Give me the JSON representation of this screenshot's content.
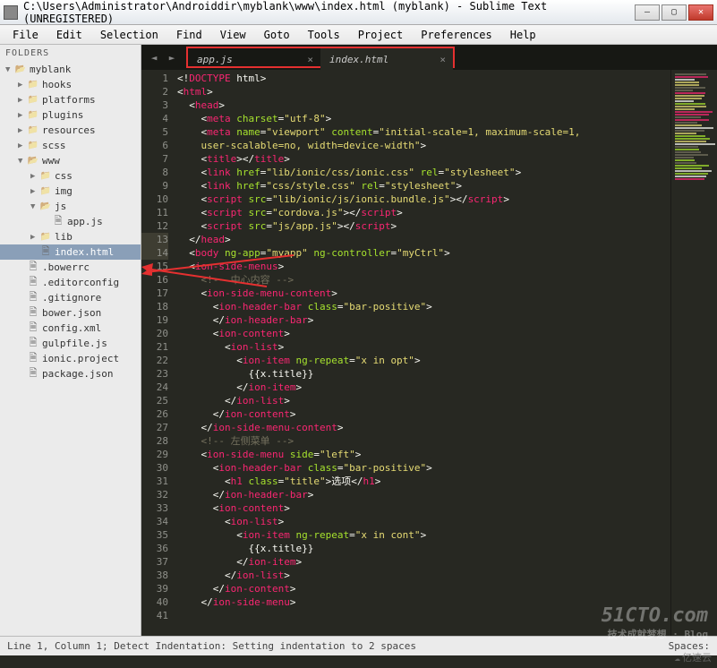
{
  "titlebar": {
    "title": "C:\\Users\\Administrator\\Androiddir\\myblank\\www\\index.html (myblank) - Sublime Text (UNREGISTERED)"
  },
  "menu": [
    "File",
    "Edit",
    "Selection",
    "Find",
    "View",
    "Goto",
    "Tools",
    "Project",
    "Preferences",
    "Help"
  ],
  "sidebar": {
    "header": "FOLDERS",
    "tree": [
      {
        "depth": 0,
        "arrow": "▼",
        "kind": "folder",
        "open": true,
        "label": "myblank"
      },
      {
        "depth": 1,
        "arrow": "▶",
        "kind": "folder",
        "label": "hooks"
      },
      {
        "depth": 1,
        "arrow": "▶",
        "kind": "folder",
        "label": "platforms"
      },
      {
        "depth": 1,
        "arrow": "▶",
        "kind": "folder",
        "label": "plugins"
      },
      {
        "depth": 1,
        "arrow": "▶",
        "kind": "folder",
        "label": "resources"
      },
      {
        "depth": 1,
        "arrow": "▶",
        "kind": "folder",
        "label": "scss"
      },
      {
        "depth": 1,
        "arrow": "▼",
        "kind": "folder",
        "open": true,
        "label": "www"
      },
      {
        "depth": 2,
        "arrow": "▶",
        "kind": "folder",
        "label": "css"
      },
      {
        "depth": 2,
        "arrow": "▶",
        "kind": "folder",
        "label": "img"
      },
      {
        "depth": 2,
        "arrow": "▼",
        "kind": "folder",
        "open": true,
        "label": "js"
      },
      {
        "depth": 3,
        "arrow": "",
        "kind": "file",
        "label": "app.js"
      },
      {
        "depth": 2,
        "arrow": "▶",
        "kind": "folder",
        "label": "lib"
      },
      {
        "depth": 2,
        "arrow": "",
        "kind": "file",
        "label": "index.html",
        "selected": true
      },
      {
        "depth": 1,
        "arrow": "",
        "kind": "file",
        "label": ".bowerrc"
      },
      {
        "depth": 1,
        "arrow": "",
        "kind": "file",
        "label": ".editorconfig"
      },
      {
        "depth": 1,
        "arrow": "",
        "kind": "file",
        "label": ".gitignore"
      },
      {
        "depth": 1,
        "arrow": "",
        "kind": "file",
        "label": "bower.json"
      },
      {
        "depth": 1,
        "arrow": "",
        "kind": "file",
        "label": "config.xml"
      },
      {
        "depth": 1,
        "arrow": "",
        "kind": "file",
        "label": "gulpfile.js"
      },
      {
        "depth": 1,
        "arrow": "",
        "kind": "file",
        "label": "ionic.project"
      },
      {
        "depth": 1,
        "arrow": "",
        "kind": "file",
        "label": "package.json"
      }
    ]
  },
  "tabs": [
    {
      "label": "app.js",
      "active": false
    },
    {
      "label": "index.html",
      "active": true
    }
  ],
  "code": {
    "start_line": 1,
    "highlight_lines": [
      13,
      14
    ],
    "lines": [
      [
        [
          "w",
          "<!"
        ],
        [
          "t",
          "DOCTYPE"
        ],
        [
          "w",
          " html"
        ],
        [
          "w",
          ">"
        ]
      ],
      [
        [
          "w",
          "<"
        ],
        [
          "t",
          "html"
        ],
        [
          "w",
          ">"
        ]
      ],
      [
        [
          "w",
          "  <"
        ],
        [
          "t",
          "head"
        ],
        [
          "w",
          ">"
        ]
      ],
      [
        [
          "w",
          "    <"
        ],
        [
          "t",
          "meta"
        ],
        [
          "w",
          " "
        ],
        [
          "a",
          "charset"
        ],
        [
          "w",
          "="
        ],
        [
          "s",
          "\"utf-8\""
        ],
        [
          "w",
          ">"
        ]
      ],
      [
        [
          "w",
          "    <"
        ],
        [
          "t",
          "meta"
        ],
        [
          "w",
          " "
        ],
        [
          "a",
          "name"
        ],
        [
          "w",
          "="
        ],
        [
          "s",
          "\"viewport\""
        ],
        [
          "w",
          " "
        ],
        [
          "a",
          "content"
        ],
        [
          "w",
          "="
        ],
        [
          "s",
          "\"initial-scale=1, maximum-scale=1, "
        ]
      ],
      [
        [
          "s",
          "    user-scalable=no, width=device-width\""
        ],
        [
          "w",
          ">"
        ]
      ],
      [
        [
          "w",
          "    <"
        ],
        [
          "t",
          "title"
        ],
        [
          "w",
          "></"
        ],
        [
          "t",
          "title"
        ],
        [
          "w",
          ">"
        ]
      ],
      [
        [
          "w",
          "    <"
        ],
        [
          "t",
          "link"
        ],
        [
          "w",
          " "
        ],
        [
          "a",
          "href"
        ],
        [
          "w",
          "="
        ],
        [
          "s",
          "\"lib/ionic/css/ionic.css\""
        ],
        [
          "w",
          " "
        ],
        [
          "a",
          "rel"
        ],
        [
          "w",
          "="
        ],
        [
          "s",
          "\"stylesheet\""
        ],
        [
          "w",
          ">"
        ]
      ],
      [
        [
          "w",
          "    <"
        ],
        [
          "t",
          "link"
        ],
        [
          "w",
          " "
        ],
        [
          "a",
          "href"
        ],
        [
          "w",
          "="
        ],
        [
          "s",
          "\"css/style.css\""
        ],
        [
          "w",
          " "
        ],
        [
          "a",
          "rel"
        ],
        [
          "w",
          "="
        ],
        [
          "s",
          "\"stylesheet\""
        ],
        [
          "w",
          ">"
        ]
      ],
      [
        [
          "w",
          "    <"
        ],
        [
          "t",
          "script"
        ],
        [
          "w",
          " "
        ],
        [
          "a",
          "src"
        ],
        [
          "w",
          "="
        ],
        [
          "s",
          "\"lib/ionic/js/ionic.bundle.js\""
        ],
        [
          "w",
          "></"
        ],
        [
          "t",
          "script"
        ],
        [
          "w",
          ">"
        ]
      ],
      [
        [
          "w",
          "    <"
        ],
        [
          "t",
          "script"
        ],
        [
          "w",
          " "
        ],
        [
          "a",
          "src"
        ],
        [
          "w",
          "="
        ],
        [
          "s",
          "\"cordova.js\""
        ],
        [
          "w",
          "></"
        ],
        [
          "t",
          "script"
        ],
        [
          "w",
          ">"
        ]
      ],
      [
        [
          "w",
          "    <"
        ],
        [
          "t",
          "script"
        ],
        [
          "w",
          " "
        ],
        [
          "a",
          "src"
        ],
        [
          "w",
          "="
        ],
        [
          "s",
          "\"js/app.js\""
        ],
        [
          "w",
          "></"
        ],
        [
          "t",
          "script"
        ],
        [
          "w",
          ">"
        ]
      ],
      [
        [
          "w",
          "  </"
        ],
        [
          "t",
          "head"
        ],
        [
          "w",
          ">"
        ]
      ],
      [
        [
          "w",
          "  <"
        ],
        [
          "t",
          "body"
        ],
        [
          "w",
          " "
        ],
        [
          "a",
          "ng-app"
        ],
        [
          "w",
          "="
        ],
        [
          "s",
          "\"myapp\""
        ],
        [
          "w",
          " "
        ],
        [
          "a",
          "ng-controller"
        ],
        [
          "w",
          "="
        ],
        [
          "s",
          "\"myCtrl\""
        ],
        [
          "w",
          ">"
        ]
      ],
      [
        [
          "w",
          "  <"
        ],
        [
          "t",
          "ion-side-menus"
        ],
        [
          "w",
          ">"
        ]
      ],
      [
        [
          "w",
          ""
        ]
      ],
      [
        [
          "w",
          "    "
        ],
        [
          "c",
          "<!-- 中心内容 -->"
        ]
      ],
      [
        [
          "w",
          "    <"
        ],
        [
          "t",
          "ion-side-menu-content"
        ],
        [
          "w",
          ">"
        ]
      ],
      [
        [
          "w",
          "      <"
        ],
        [
          "t",
          "ion-header-bar"
        ],
        [
          "w",
          " "
        ],
        [
          "a",
          "class"
        ],
        [
          "w",
          "="
        ],
        [
          "s",
          "\"bar-positive\""
        ],
        [
          "w",
          ">"
        ]
      ],
      [
        [
          "w",
          "      </"
        ],
        [
          "t",
          "ion-header-bar"
        ],
        [
          "w",
          ">"
        ]
      ],
      [
        [
          "w",
          "      <"
        ],
        [
          "t",
          "ion-content"
        ],
        [
          "w",
          ">"
        ]
      ],
      [
        [
          "w",
          "        <"
        ],
        [
          "t",
          "ion-list"
        ],
        [
          "w",
          ">"
        ]
      ],
      [
        [
          "w",
          "          <"
        ],
        [
          "t",
          "ion-item"
        ],
        [
          "w",
          " "
        ],
        [
          "a",
          "ng-repeat"
        ],
        [
          "w",
          "="
        ],
        [
          "s",
          "\"x in opt\""
        ],
        [
          "w",
          ">"
        ]
      ],
      [
        [
          "w",
          "            {{x.title}}"
        ]
      ],
      [
        [
          "w",
          "          </"
        ],
        [
          "t",
          "ion-item"
        ],
        [
          "w",
          ">"
        ]
      ],
      [
        [
          "w",
          "        </"
        ],
        [
          "t",
          "ion-list"
        ],
        [
          "w",
          ">"
        ]
      ],
      [
        [
          "w",
          "      </"
        ],
        [
          "t",
          "ion-content"
        ],
        [
          "w",
          ">"
        ]
      ],
      [
        [
          "w",
          "    </"
        ],
        [
          "t",
          "ion-side-menu-content"
        ],
        [
          "w",
          ">"
        ]
      ],
      [
        [
          "w",
          ""
        ]
      ],
      [
        [
          "w",
          "    "
        ],
        [
          "c",
          "<!-- 左侧菜单 -->"
        ]
      ],
      [
        [
          "w",
          "    <"
        ],
        [
          "t",
          "ion-side-menu"
        ],
        [
          "w",
          " "
        ],
        [
          "a",
          "side"
        ],
        [
          "w",
          "="
        ],
        [
          "s",
          "\"left\""
        ],
        [
          "w",
          ">"
        ]
      ],
      [
        [
          "w",
          "      <"
        ],
        [
          "t",
          "ion-header-bar"
        ],
        [
          "w",
          " "
        ],
        [
          "a",
          "class"
        ],
        [
          "w",
          "="
        ],
        [
          "s",
          "\"bar-positive\""
        ],
        [
          "w",
          ">"
        ]
      ],
      [
        [
          "w",
          "        <"
        ],
        [
          "t",
          "h1"
        ],
        [
          "w",
          " "
        ],
        [
          "a",
          "class"
        ],
        [
          "w",
          "="
        ],
        [
          "s",
          "\"title\""
        ],
        [
          "w",
          ">选项</"
        ],
        [
          "t",
          "h1"
        ],
        [
          "w",
          ">"
        ]
      ],
      [
        [
          "w",
          "      </"
        ],
        [
          "t",
          "ion-header-bar"
        ],
        [
          "w",
          ">"
        ]
      ],
      [
        [
          "w",
          "      <"
        ],
        [
          "t",
          "ion-content"
        ],
        [
          "w",
          ">"
        ]
      ],
      [
        [
          "w",
          "        <"
        ],
        [
          "t",
          "ion-list"
        ],
        [
          "w",
          ">"
        ]
      ],
      [
        [
          "w",
          "          <"
        ],
        [
          "t",
          "ion-item"
        ],
        [
          "w",
          " "
        ],
        [
          "a",
          "ng-repeat"
        ],
        [
          "w",
          "="
        ],
        [
          "s",
          "\"x in cont\""
        ],
        [
          "w",
          ">"
        ]
      ],
      [
        [
          "w",
          "            {{x.title}}"
        ]
      ],
      [
        [
          "w",
          "          </"
        ],
        [
          "t",
          "ion-item"
        ],
        [
          "w",
          ">"
        ]
      ],
      [
        [
          "w",
          "        </"
        ],
        [
          "t",
          "ion-list"
        ],
        [
          "w",
          ">"
        ]
      ],
      [
        [
          "w",
          "      </"
        ],
        [
          "t",
          "ion-content"
        ],
        [
          "w",
          ">"
        ]
      ],
      [
        [
          "w",
          "    </"
        ],
        [
          "t",
          "ion-side-menu"
        ],
        [
          "w",
          ">"
        ]
      ]
    ]
  },
  "statusbar": {
    "left": "Line 1, Column 1; Detect Indentation: Setting indentation to 2 spaces",
    "right": "Spaces:"
  },
  "watermark": {
    "big": "51CTO.com",
    "small": "技术成就梦想 · Blog"
  },
  "cloud": "亿速云"
}
